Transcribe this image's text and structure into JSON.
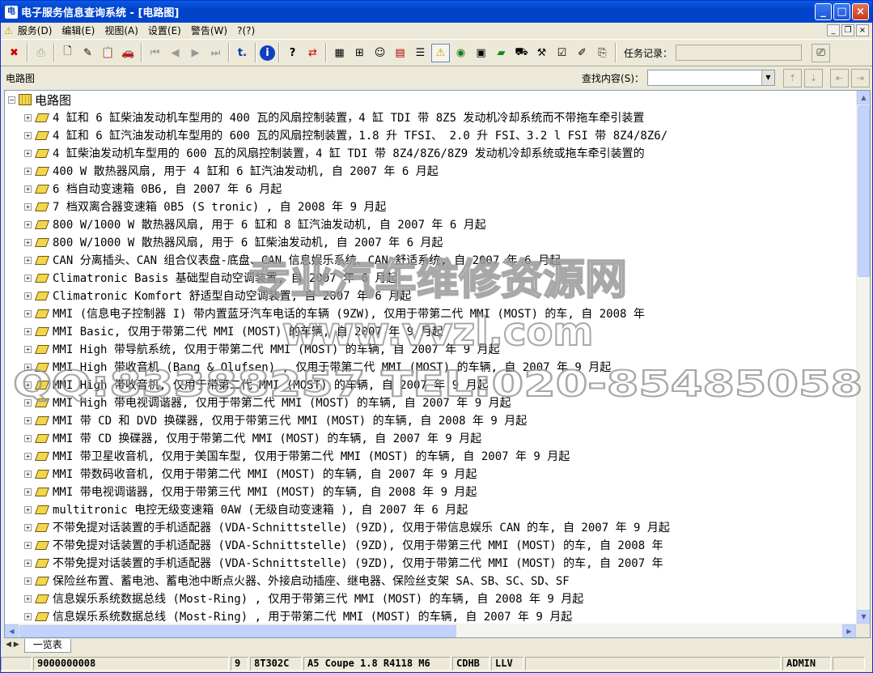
{
  "window": {
    "title": "电子服务信息查询系统 - [电路图]"
  },
  "menu": {
    "items": [
      "服务(D)",
      "编辑(E)",
      "视图(A)",
      "设置(E)",
      "警告(W)",
      "?(?)"
    ]
  },
  "toolbar": {
    "task_label": "任务记录："
  },
  "bar2": {
    "breadcrumb": "电路图",
    "search_label": "查找内容(S)：",
    "search_value": ""
  },
  "tree": {
    "root": "电路图",
    "items": [
      "4 缸和 6 缸柴油发动机车型用的 400 瓦的风扇控制装置，4 缸 TDI 带 8Z5 发动机冷却系统而不带拖车牵引装置",
      "4 缸和 6 缸汽油发动机车型用的 600 瓦的风扇控制装置，1.8 升 TFSI、 2.0 升 FSI、3.2 l FSI 带 8Z4/8Z6/",
      "4 缸柴油发动机车型用的 600 瓦的风扇控制装置，4 缸 TDI 带 8Z4/8Z6/8Z9 发动机冷却系统或拖车牵引装置的",
      "400 W 散热器风扇, 用于 4 缸和 6 缸汽油发动机, 自 2007 年 6 月起",
      "6 档自动变速箱 0B6, 自 2007 年 6 月起",
      "7 档双离合器变速箱 0B5 (S tronic) , 自 2008 年 9 月起",
      "800 W/1000 W 散热器风扇, 用于 6 缸和 8 缸汽油发动机, 自 2007 年 6 月起",
      "800 W/1000 W 散热器风扇, 用于 6 缸柴油发动机, 自 2007 年 6 月起",
      "CAN 分离插头、CAN 组合仪表盘-底盘、CAN 信息娱乐系统、CAN 舒适系统, 自 2007 年 6 月起",
      "Climatronic Basis 基础型自动空调装置, 自 2007 年 6 月起",
      "Climatronic Komfort 舒适型自动空调装置, 自 2007 年 6 月起",
      "MMI (信息电子控制器 I) 带内置蓝牙汽车电话的车辆 (9ZW), 仅用于带第二代 MMI (MOST) 的车, 自 2008 年",
      "MMI Basic, 仅用于带第二代 MMI (MOST) 的车辆, 自 2007 年 9 月起",
      "MMI High 带导航系统, 仅用于带第二代 MMI (MOST) 的车辆, 自 2007 年 9 月起",
      "MMI High 带收音机 (Bang & Olufsen) , 仅用于带第二代 MMI (MOST) 的车辆, 自 2007 年 9 月起",
      "MMI High 带收音机, 仅用于带第二代 MMI (MOST) 的车辆, 自 2007 年 9 月起",
      "MMI High 带电视调谐器, 仅用于带第二代 MMI (MOST) 的车辆, 自 2007 年 9 月起",
      "MMI 带 CD 和 DVD 换碟器, 仅用于带第三代 MMI (MOST) 的车辆, 自 2008 年 9 月起",
      "MMI 带 CD 换碟器, 仅用于带第二代 MMI (MOST) 的车辆, 自 2007 年 9 月起",
      "MMI 带卫星收音机, 仅用于美国车型, 仅用于带第二代 MMI (MOST) 的车辆, 自 2007 年 9 月起",
      "MMI 带数码收音机, 仅用于带第二代 MMI (MOST) 的车辆, 自 2007 年 9 月起",
      "MMI 带电视调谐器, 仅用于带第三代 MMI (MOST) 的车辆, 自 2008 年 9 月起",
      "multitronic 电控无级变速箱 0AW (无级自动变速箱 ), 自 2007 年 6 月起",
      "不带免提对话装置的手机适配器 (VDA-Schnittstelle) (9ZD), 仅用于带信息娱乐 CAN 的车, 自 2007 年 9 月起",
      "不带免提对话装置的手机适配器 (VDA-Schnittstelle) (9ZD), 仅用于带第三代 MMI (MOST) 的车, 自 2008 年",
      "不带免提对话装置的手机适配器 (VDA-Schnittstelle) (9ZD), 仅用于带第二代 MMI (MOST) 的车, 自 2007 年",
      "保险丝布置、蓄电池、蓄电池中断点火器、外接启动插座、继电器、保险丝支架 SA、SB、SC、SD、SF",
      "信息娱乐系统数据总线 (Most-Ring) , 仅用于带第三代 MMI (MOST) 的车辆, 自 2008 年 9 月起",
      "信息娱乐系统数据总线 (Most-Ring) , 用于带第二代 MMI (MOST) 的车辆, 自 2007 年 9 月起"
    ]
  },
  "tabs": {
    "active": "一览表"
  },
  "status": {
    "s1": "9000000008",
    "s2": "9",
    "s3": "8T302C",
    "s4": "A5 Coupe 1.8 R4118 M6",
    "s5": "CDHB",
    "s6": "LLV",
    "s7": "ADMIN"
  },
  "watermark": {
    "line1": "专业汽车维修资源网",
    "line2": "www.vvzl.com",
    "line3": "QQ:83388257 TEL:020-85485058"
  }
}
